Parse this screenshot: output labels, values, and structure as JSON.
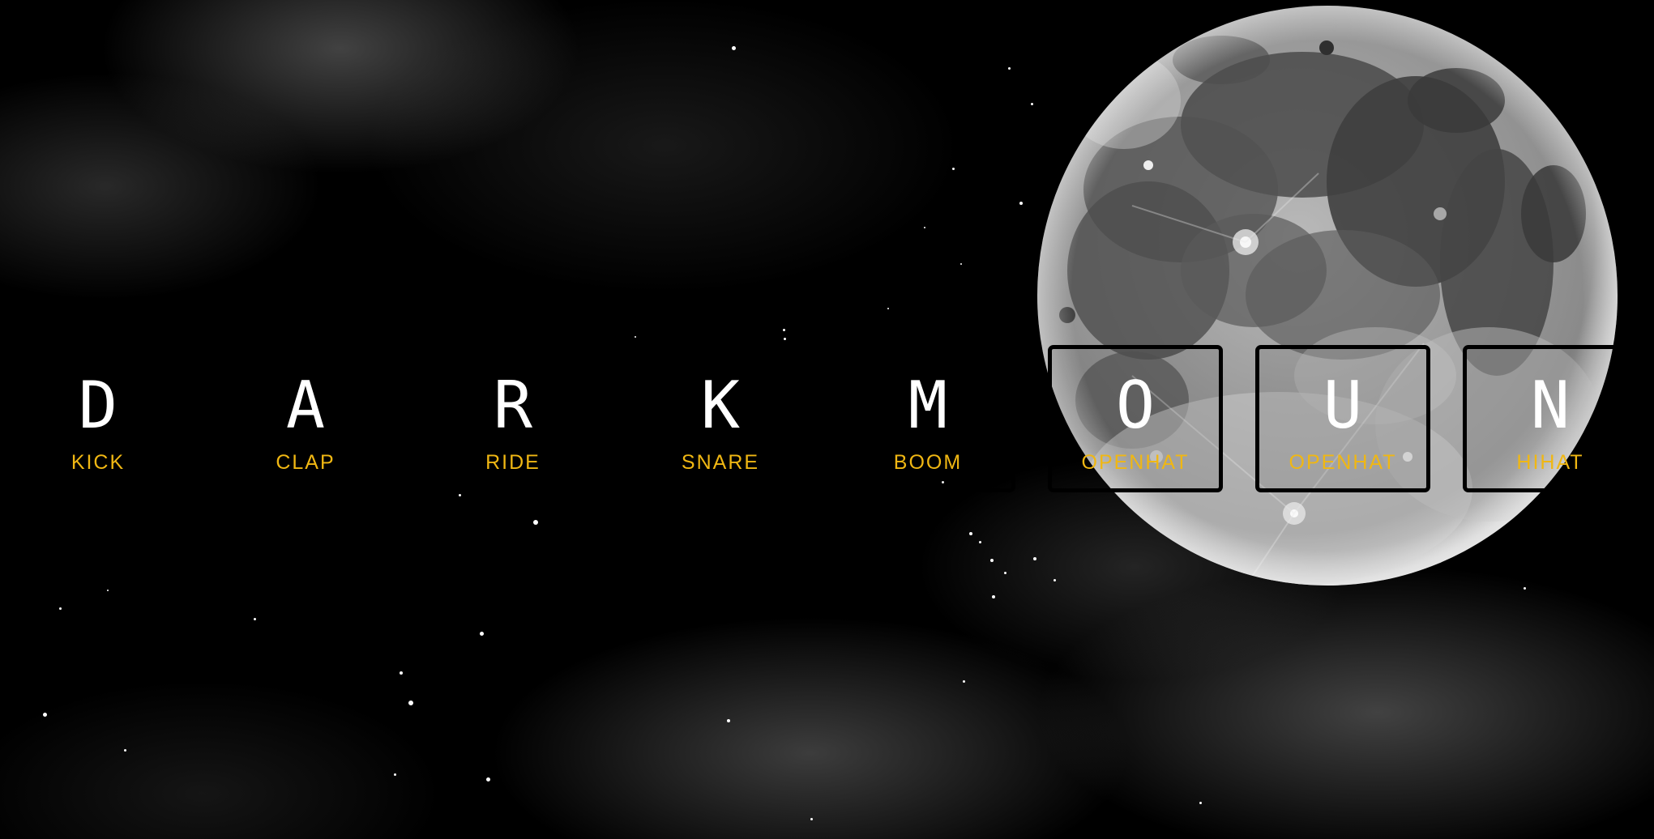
{
  "keys": [
    {
      "letter": "D",
      "sound": "KICK"
    },
    {
      "letter": "A",
      "sound": "CLAP"
    },
    {
      "letter": "R",
      "sound": "RIDE"
    },
    {
      "letter": "K",
      "sound": "SNARE"
    },
    {
      "letter": "M",
      "sound": "BOOM"
    },
    {
      "letter": "O",
      "sound": "OPENHAT"
    },
    {
      "letter": "U",
      "sound": "OPENHAT"
    },
    {
      "letter": "N",
      "sound": "HIHAT"
    }
  ],
  "colors": {
    "background": "#000000",
    "letter": "#ffffff",
    "sound_label": "#f0b713",
    "key_border": "#000000"
  },
  "background_image": "moon-night-sky"
}
